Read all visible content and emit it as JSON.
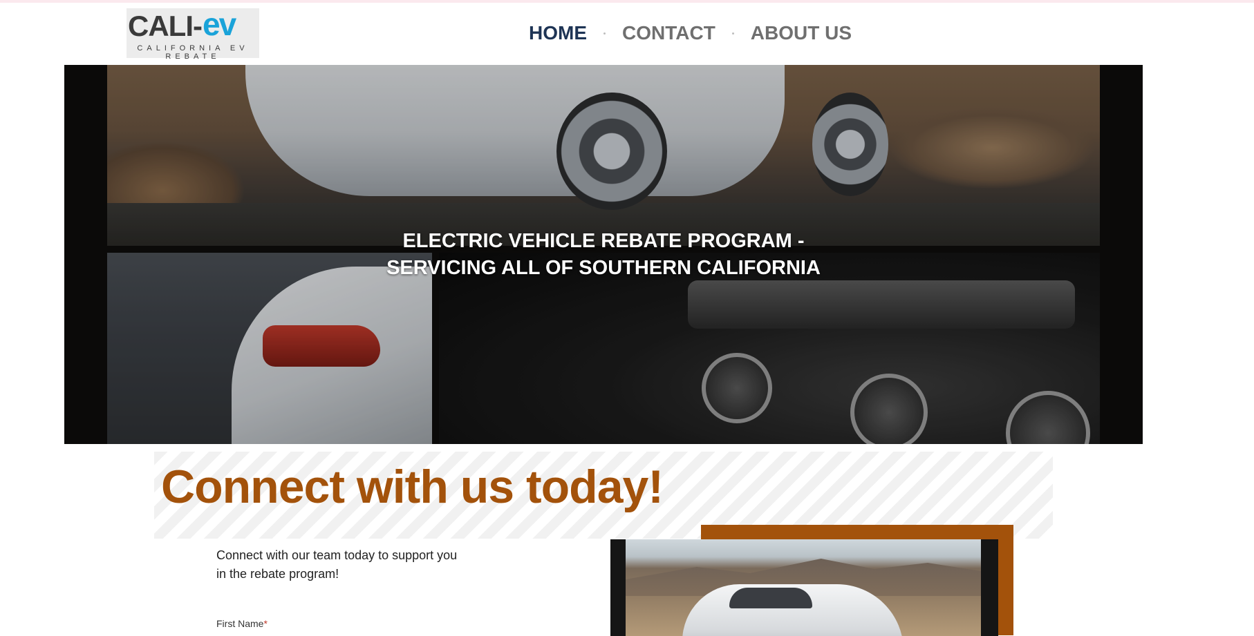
{
  "header": {
    "logo": {
      "main_text": "CALI-",
      "ev_text": "ev",
      "sub_line1": "CALIFORNIA EV",
      "sub_line2": "REBATE"
    },
    "nav": [
      {
        "label": "HOME",
        "active": true
      },
      {
        "label": "CONTACT",
        "active": false
      },
      {
        "label": "ABOUT US",
        "active": false
      }
    ]
  },
  "hero": {
    "title_line1": "ELECTRIC VEHICLE REBATE PROGRAM -",
    "title_line2": "SERVICING ALL OF SOUTHERN CALIFORNIA"
  },
  "connect": {
    "title": "Connect with us today!",
    "intro_line1": "Connect with our team today to support you",
    "intro_line2": "in the rebate program!",
    "form": {
      "first_name_label": "First Name",
      "required_mark": "*"
    }
  },
  "colors": {
    "accent": "#a3520b",
    "nav_active": "#1e3455",
    "nav_inactive": "#6f6f6f",
    "ev_blue": "#1aa3d9"
  }
}
